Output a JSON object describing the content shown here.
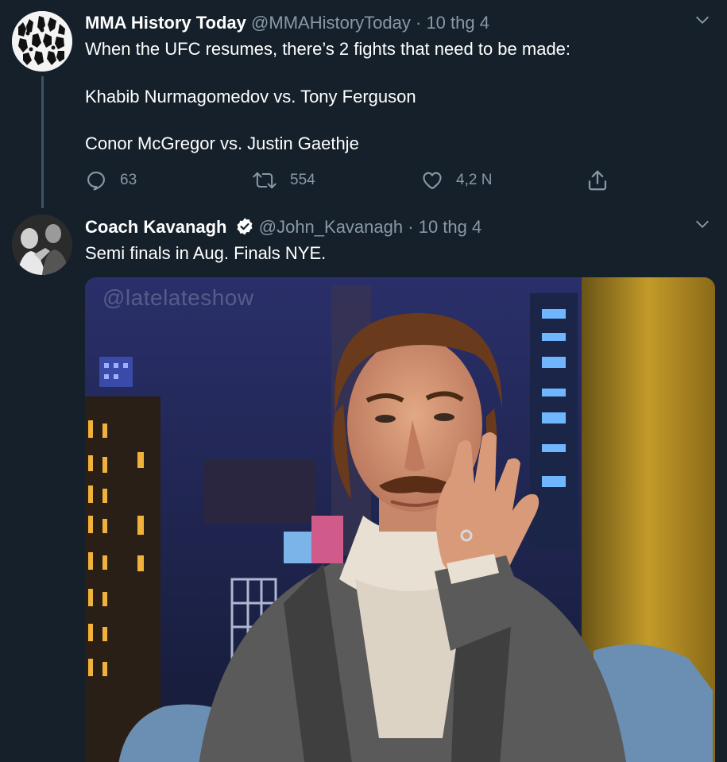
{
  "tweets": [
    {
      "author_name": "MMA History Today",
      "handle": "@MMAHistoryToday",
      "separator": "·",
      "date": "10 thg 4",
      "lines": [
        "When the UFC resumes, there’s 2 fights that need to be made:",
        "Khabib Nurmagomedov vs. Tony Ferguson",
        "Conor McGregor vs. Justin Gaethje"
      ],
      "actions": {
        "reply": {
          "icon": "reply-icon",
          "count": "63"
        },
        "retweet": {
          "icon": "retweet-icon",
          "count": "554"
        },
        "like": {
          "icon": "heart-icon",
          "count": "4,2 N"
        },
        "share": {
          "icon": "share-icon"
        }
      }
    },
    {
      "author_name": "Coach Kavanagh",
      "verified": true,
      "handle": "@John_Kavanagh",
      "separator": "·",
      "date": "10 thg 4",
      "lines": [
        "Semi finals in Aug. Finals NYE."
      ],
      "media": {
        "type": "gif",
        "watermark": "@latelateshow"
      }
    }
  ],
  "colors": {
    "background": "#15202b",
    "text": "#ffffff",
    "secondary": "#8899a6",
    "thread_line": "#3d5466"
  }
}
